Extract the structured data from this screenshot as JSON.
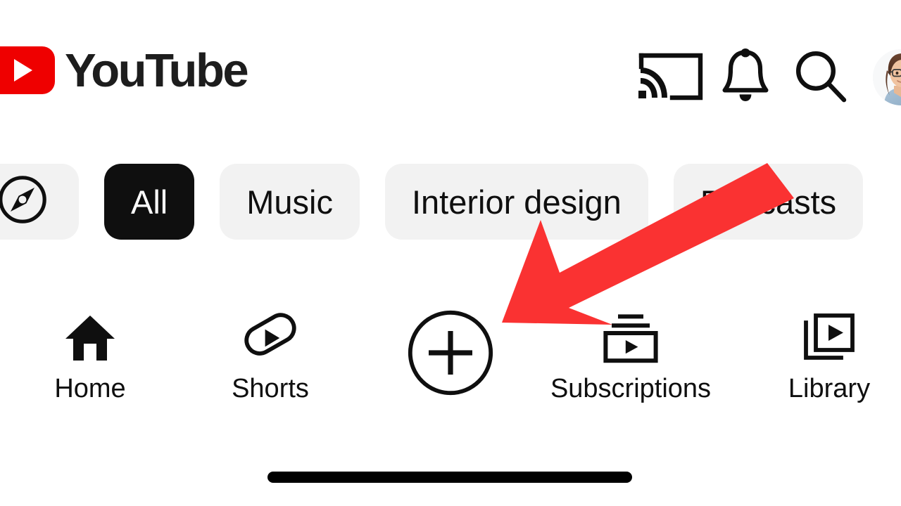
{
  "app": {
    "name": "YouTube",
    "platform_surface": "mobile-app-home"
  },
  "header": {
    "logo_text": "YouTube",
    "logo_color": "#ef0000",
    "actions": [
      {
        "id": "cast",
        "icon": "cast-icon",
        "label": "Cast"
      },
      {
        "id": "notifications",
        "icon": "bell-icon",
        "label": "Notifications"
      },
      {
        "id": "search",
        "icon": "search-icon",
        "label": "Search"
      },
      {
        "id": "account",
        "icon": "avatar",
        "label": "Account"
      }
    ]
  },
  "chips": [
    {
      "id": "explore",
      "label": "",
      "icon": "compass-icon",
      "active": false
    },
    {
      "id": "all",
      "label": "All",
      "icon": "",
      "active": true
    },
    {
      "id": "music",
      "label": "Music",
      "icon": "",
      "active": false
    },
    {
      "id": "interior-design",
      "label": "Interior design",
      "icon": "",
      "active": false
    },
    {
      "id": "podcasts",
      "label": "Podcasts",
      "icon": "",
      "active": false
    }
  ],
  "bottom_nav": [
    {
      "id": "home",
      "label": "Home",
      "icon": "home-icon",
      "active": true
    },
    {
      "id": "shorts",
      "label": "Shorts",
      "icon": "shorts-icon",
      "active": false
    },
    {
      "id": "create",
      "label": "",
      "icon": "plus-circle-icon",
      "active": false
    },
    {
      "id": "subscriptions",
      "label": "Subscriptions",
      "icon": "subscriptions-icon",
      "active": false
    },
    {
      "id": "library",
      "label": "Library",
      "icon": "library-icon",
      "active": false
    }
  ],
  "annotation": {
    "type": "arrow",
    "color": "#fa3232",
    "points_to": "create-button",
    "direction": "down-left"
  },
  "colors": {
    "background": "#ffffff",
    "chip_bg": "#f2f2f2",
    "chip_active_bg": "#0f0f0f",
    "text": "#0f0f0f",
    "brand_red": "#ef0000",
    "annotation_red": "#fa3232"
  }
}
